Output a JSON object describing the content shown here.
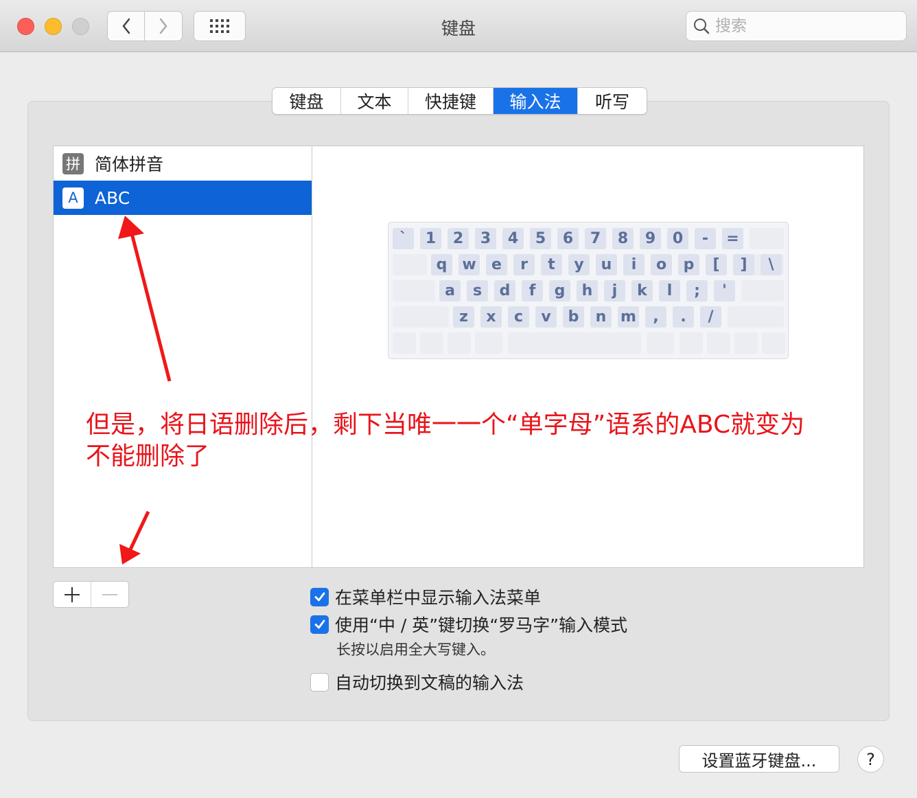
{
  "window": {
    "title": "键盘",
    "search_placeholder": "搜索"
  },
  "tabs": [
    {
      "label": "键盘"
    },
    {
      "label": "文本"
    },
    {
      "label": "快捷键"
    },
    {
      "label": "输入法",
      "active": true
    },
    {
      "label": "听写"
    }
  ],
  "input_sources": [
    {
      "icon_char": "拼",
      "label": "简体拼音"
    },
    {
      "icon_char": "A",
      "label": "ABC",
      "selected": true
    }
  ],
  "keyboard_rows": [
    [
      "`",
      "1",
      "2",
      "3",
      "4",
      "5",
      "6",
      "7",
      "8",
      "9",
      "0",
      "-",
      "="
    ],
    [
      "q",
      "w",
      "e",
      "r",
      "t",
      "y",
      "u",
      "i",
      "o",
      "p",
      "[",
      "]",
      "\\"
    ],
    [
      "a",
      "s",
      "d",
      "f",
      "g",
      "h",
      "j",
      "k",
      "l",
      ";",
      "'"
    ],
    [
      "z",
      "x",
      "c",
      "v",
      "b",
      "n",
      "m",
      ",",
      ".",
      "/"
    ]
  ],
  "buttons": {
    "add": "+",
    "remove": "—",
    "bluetooth": "设置蓝牙键盘...",
    "help": "?"
  },
  "options": [
    {
      "label": "在菜单栏中显示输入法菜单",
      "checked": true
    },
    {
      "label": "使用“中 / 英”键切换“罗马字”输入模式",
      "checked": true
    },
    {
      "label": "自动切换到文稿的输入法",
      "checked": false
    }
  ],
  "option_note": "长按以启用全大写键入。",
  "annotation": {
    "line1": "但是，将日语删除后，剩下当唯一一个“单字母”语系的ABC就变为",
    "line2": "不能删除了",
    "color": "#e8141b"
  },
  "colors": {
    "accent": "#1a72e8",
    "selection": "#0e63d6"
  }
}
